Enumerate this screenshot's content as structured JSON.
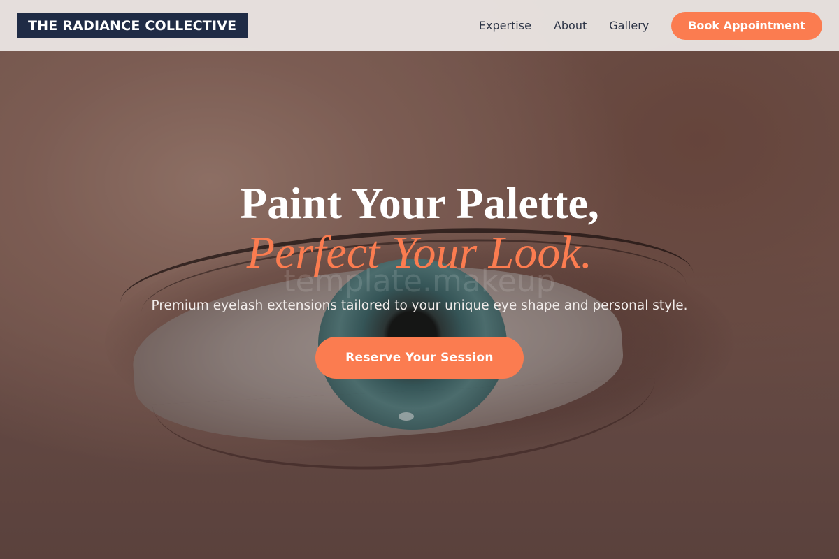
{
  "brand": {
    "name": "THE RADIANCE COLLECTIVE"
  },
  "nav": {
    "links": [
      "Expertise",
      "About",
      "Gallery"
    ],
    "cta_label": "Book Appointment"
  },
  "hero": {
    "headline_line1": "Paint Your Palette,",
    "headline_line2": "Perfect Your Look.",
    "watermark": "template.makeup",
    "subtitle": "Premium eyelash extensions tailored to your unique eye shape and personal style.",
    "cta_label": "Reserve Your Session",
    "background_image": "eye-closeup-photo"
  },
  "colors": {
    "accent": "#fb7c50",
    "brand_bg": "#1f2b45",
    "header_bg": "#ebe6e4"
  }
}
